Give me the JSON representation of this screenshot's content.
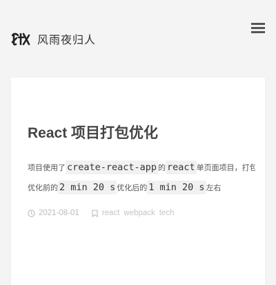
{
  "site": {
    "name": "风雨夜归人",
    "logo_text": "狄"
  },
  "post": {
    "title": "React 项目打包优化",
    "excerpt_line1": {
      "prefix": "项目使用了",
      "code1": "create-react-app",
      "middle": "的",
      "code2": "react",
      "suffix": "单页面项目，打包时间过长，从"
    },
    "excerpt_line2": {
      "prefix": "优化前的",
      "code1": "2 min 20 s",
      "middle": "优化后的",
      "code2": "1 min 20 s",
      "suffix": "左右"
    },
    "date": "2021-08-01",
    "tags": [
      "react",
      "webpack",
      "tech"
    ]
  },
  "colors": {
    "background": "#f4f4f4",
    "card": "#ffffff",
    "meta": "#bbbbbb"
  },
  "icons": {
    "menu": "hamburger-icon",
    "date": "clock-icon",
    "tags": "bookmark-icon"
  }
}
